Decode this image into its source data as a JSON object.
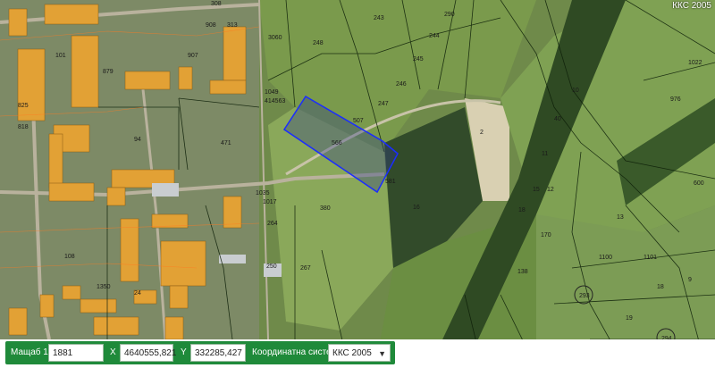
{
  "map": {
    "crs_corner": "ККС 2005",
    "highlight_parcel": "566",
    "parcel_numbers": [
      "3060",
      "248",
      "243",
      "290",
      "245",
      "244",
      "247",
      "246",
      "507",
      "566",
      "2",
      "581",
      "16",
      "380",
      "264",
      "250",
      "267",
      "471",
      "94",
      "1017",
      "818",
      "825",
      "879",
      "907",
      "908",
      "1049",
      "414563",
      "308",
      "313",
      "101",
      "40",
      "10",
      "976",
      "600",
      "1022",
      "11",
      "12",
      "293",
      "294",
      "18",
      "19",
      "20",
      "9",
      "13",
      "138",
      "1100",
      "1101",
      "15",
      "170",
      "18",
      "1035",
      "108",
      "24",
      "1350",
      "14"
    ],
    "colors": {
      "selection": "#1a2cff",
      "building": "#e2a135",
      "field_light": "#d9d0b2"
    }
  },
  "toolbar": {
    "scale_label": "Мащаб  1:",
    "scale_value": "1881",
    "x_label": "X",
    "x_value": "4640555,821",
    "y_label": "Y",
    "y_value": "332285,427",
    "crs_label": "Координатна система",
    "crs_value": "ККС 2005"
  }
}
